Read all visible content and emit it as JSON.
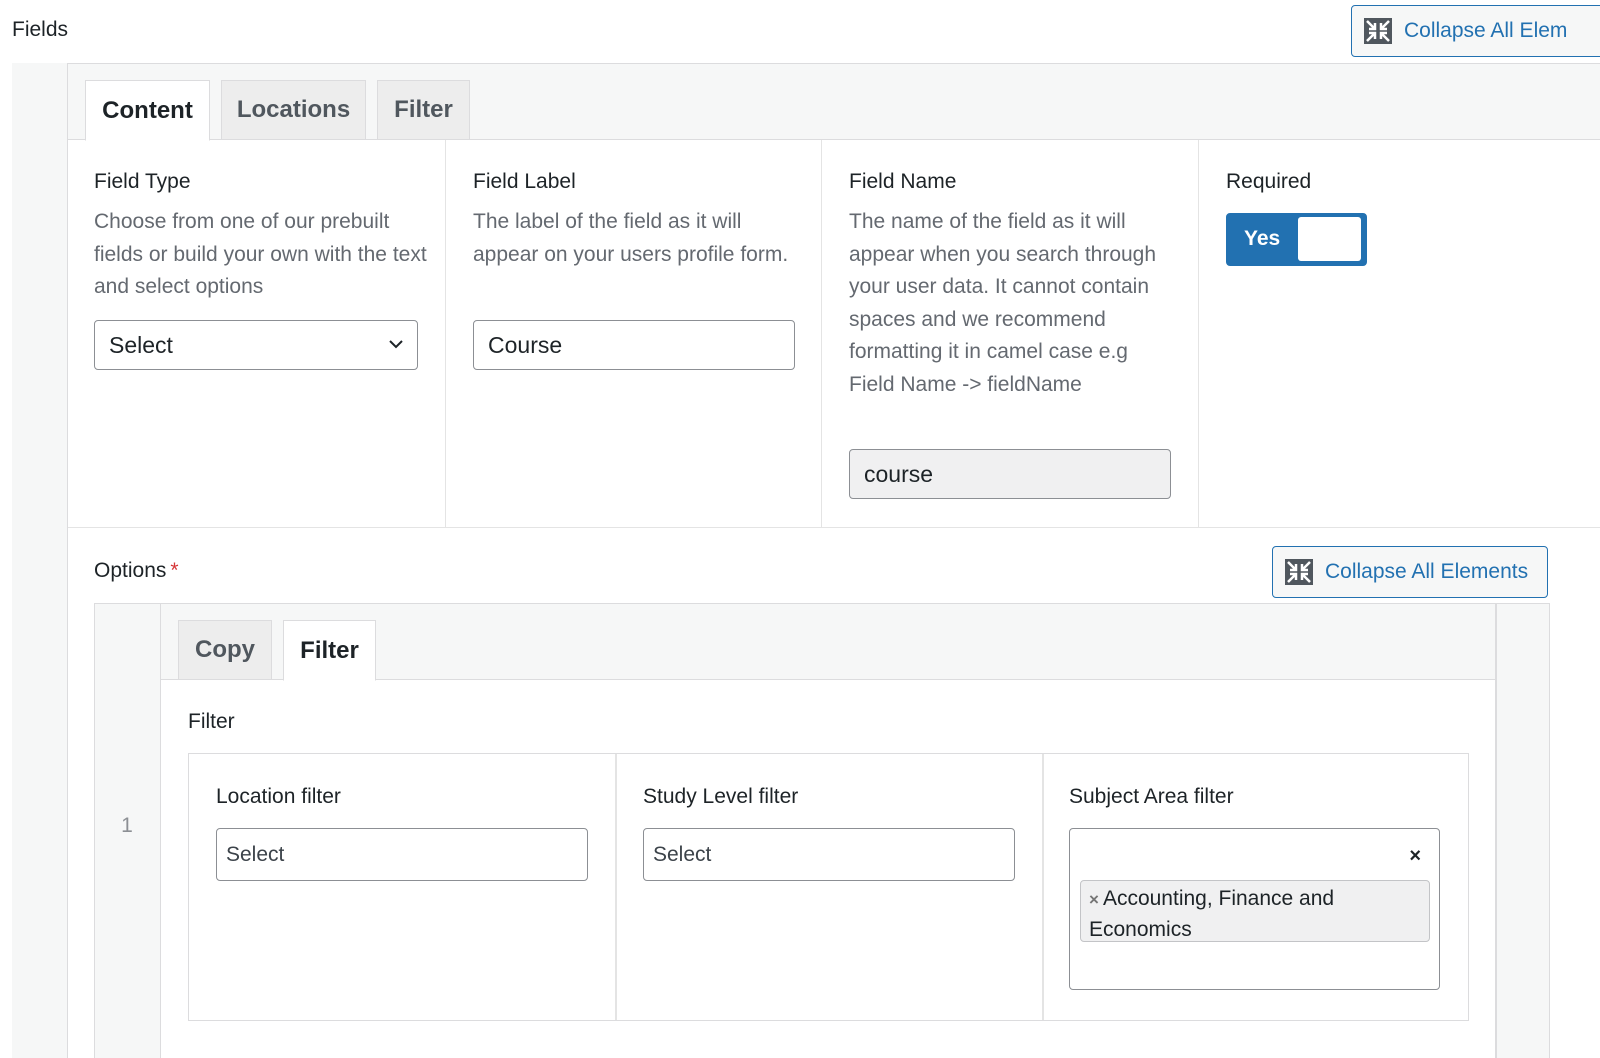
{
  "header": {
    "title": "Fields",
    "collapse_label": "Collapse All Elem"
  },
  "outer_tabs": [
    {
      "label": "Content",
      "active": true
    },
    {
      "label": "Locations",
      "active": false
    },
    {
      "label": "Filter",
      "active": false
    }
  ],
  "field_type": {
    "label": "Field Type",
    "description": "Choose from one of our prebuilt fields or build your own with the text and select options",
    "value": "Select"
  },
  "field_label": {
    "label": "Field Label",
    "description": "The label of the field as it will appear on your users profile form.",
    "value": "Course"
  },
  "field_name": {
    "label": "Field Name",
    "description": "The name of the field as it will appear when you search through your user data. It cannot contain spaces and we recommend formatting it in camel case e.g Field Name -> fieldName",
    "value": "course"
  },
  "required": {
    "label": "Required",
    "toggle_label": "Yes",
    "value": true
  },
  "options": {
    "label": "Options",
    "required_marker": "*",
    "collapse_label": "Collapse All Elements",
    "row_number": "1",
    "tabs": [
      {
        "label": "Copy",
        "active": false
      },
      {
        "label": "Filter",
        "active": true
      }
    ],
    "filter_title": "Filter",
    "location_filter": {
      "label": "Location filter",
      "placeholder": "Select"
    },
    "study_level_filter": {
      "label": "Study Level filter",
      "placeholder": "Select"
    },
    "subject_area_filter": {
      "label": "Subject Area filter",
      "clear_icon": "×",
      "remove_icon": "×",
      "selected": "Accounting, Finance and Economics"
    }
  },
  "colors": {
    "accent": "#2271b1",
    "required": "#d63638",
    "border": "#dcdcde"
  }
}
